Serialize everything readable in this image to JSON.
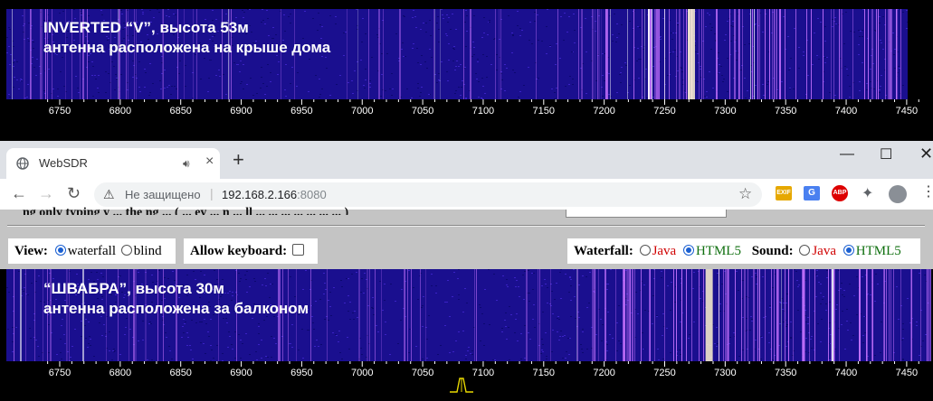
{
  "top_waterfall": {
    "caption_line1": "INVERTED “V”, высота 53м",
    "caption_line2": "антенна расположена на крыше дома"
  },
  "bottom_waterfall": {
    "caption_line1": "“ШВАБРА”, высота 30м",
    "caption_line2": "антенна расположена за балконом"
  },
  "scale_labels": [
    "6750",
    "6800",
    "6850",
    "6900",
    "6950",
    "7000",
    "7050",
    "7100",
    "7150",
    "7200",
    "7250",
    "7300",
    "7350",
    "7400",
    "7450"
  ],
  "browser": {
    "tab_title": "WebSDR",
    "new_tab": "+",
    "security_label": "Не защищено",
    "url_host": "192.168.2.166",
    "url_port": ":8080",
    "extensions": [
      "EXIF",
      "G",
      "ABP"
    ]
  },
  "page": {
    "cut_text": "ng only typing y  ...  the  ng  ... (  ...  ey  ... n  ... ll  ...  ...  ...  ...  ...  ...  ... )",
    "view_label": "View:",
    "view_options": [
      "waterfall",
      "blind"
    ],
    "view_selected": "waterfall",
    "keyboard_label": "Allow keyboard:",
    "waterfall_label": "Waterfall:",
    "sound_label": "Sound:",
    "opt_java": "Java",
    "opt_html5": "HTML5"
  },
  "colors": {
    "waterfall_bg": "#1a0f8f",
    "signal": "#c873ff",
    "accent_blue": "#1a5fd1",
    "java_red": "#d00000",
    "html5_green": "#107010",
    "marker_yellow": "#e8d800"
  }
}
